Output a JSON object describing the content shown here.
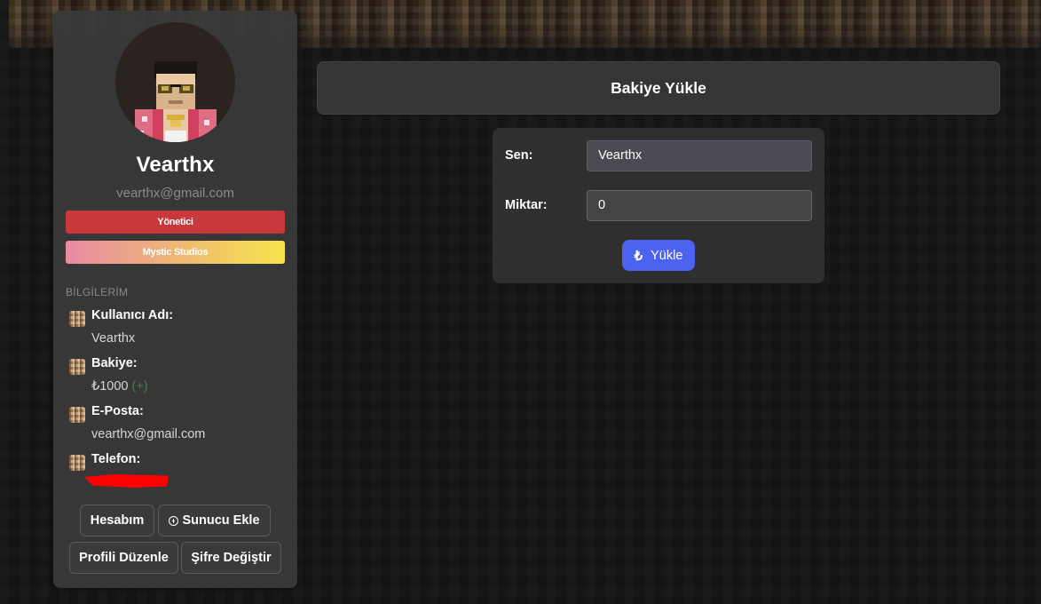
{
  "profile": {
    "username": "Vearthx",
    "email": "vearthx@gmail.com",
    "role_badge": "Yönetici",
    "team_badge": "Mystic Studios"
  },
  "info": {
    "section_title": "BİLGİLERİM",
    "items": [
      {
        "label": "Kullanıcı Adı:",
        "value": "Vearthx"
      },
      {
        "label": "Bakiye:",
        "value": "₺1000",
        "extra": "(+)"
      },
      {
        "label": "E-Posta:",
        "value": "vearthx@gmail.com"
      },
      {
        "label": "Telefon:",
        "value": ""
      }
    ]
  },
  "buttons": {
    "account": "Hesabım",
    "add_server": "Sunucu Ekle",
    "edit_profile": "Profili Düzenle",
    "change_password": "Şifre Değiştir"
  },
  "main": {
    "title": "Bakiye Yükle",
    "form": {
      "sender_label": "Sen:",
      "sender_value": "Vearthx",
      "amount_label": "Miktar:",
      "amount_value": "0",
      "submit_icon": "₺",
      "submit_label": "Yükle"
    }
  },
  "colors": {
    "role_badge": "#c8383d",
    "team_badge_from": "#e88aa2",
    "team_badge_to": "#f5e44a",
    "primary_button": "#4c63f0",
    "redaction": "#ff0000"
  }
}
